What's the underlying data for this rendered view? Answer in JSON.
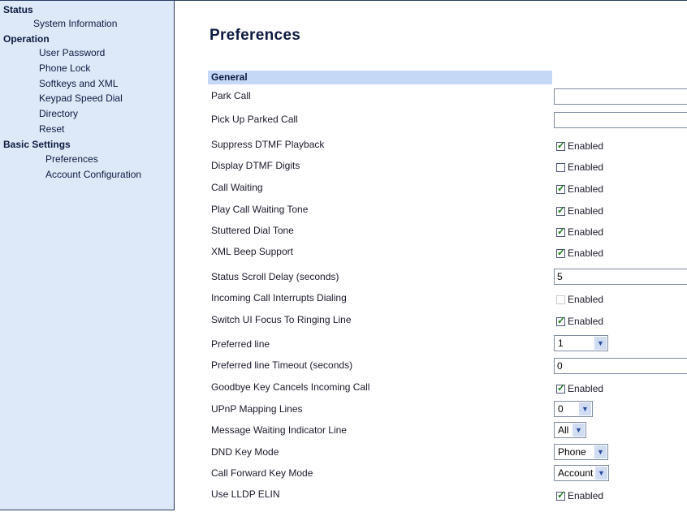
{
  "sidebar": {
    "groups": [
      {
        "label": "Status",
        "items": [
          {
            "label": "System Information"
          }
        ]
      },
      {
        "label": "Operation",
        "items": [
          {
            "label": "User Password"
          },
          {
            "label": "Phone Lock"
          },
          {
            "label": "Softkeys and XML"
          },
          {
            "label": "Keypad Speed Dial"
          },
          {
            "label": "Directory"
          },
          {
            "label": "Reset"
          }
        ]
      },
      {
        "label": "Basic Settings",
        "items": [
          {
            "label": "Preferences"
          },
          {
            "label": "Account Configuration"
          }
        ]
      }
    ]
  },
  "main": {
    "title": "Preferences",
    "section": "General",
    "enabled_label": "Enabled",
    "rows": [
      {
        "label": "Park Call",
        "type": "text",
        "value": ""
      },
      {
        "label": "Pick Up Parked Call",
        "type": "text",
        "value": ""
      },
      {
        "label": "Suppress DTMF Playback",
        "type": "checkbox",
        "checked": true
      },
      {
        "label": "Display DTMF Digits",
        "type": "checkbox",
        "checked": false
      },
      {
        "label": "Call Waiting",
        "type": "checkbox",
        "checked": true
      },
      {
        "label": "Play Call Waiting Tone",
        "type": "checkbox",
        "checked": true
      },
      {
        "label": "Stuttered Dial Tone",
        "type": "checkbox",
        "checked": true
      },
      {
        "label": "XML Beep Support",
        "type": "checkbox",
        "checked": true
      },
      {
        "label": "Status Scroll Delay (seconds)",
        "type": "text",
        "value": "5"
      },
      {
        "label": "Incoming Call Interrupts Dialing",
        "type": "checkbox",
        "checked": false
      },
      {
        "label": "Switch UI Focus To Ringing Line",
        "type": "checkbox",
        "checked": true
      },
      {
        "label": "Preferred line",
        "type": "select",
        "value": "1"
      },
      {
        "label": "Preferred line Timeout (seconds)",
        "type": "text",
        "value": "0"
      },
      {
        "label": "Goodbye Key Cancels Incoming Call",
        "type": "checkbox",
        "checked": true
      },
      {
        "label": "UPnP Mapping Lines",
        "type": "select",
        "value": "0"
      },
      {
        "label": "Message Waiting Indicator Line",
        "type": "select",
        "value": "All"
      },
      {
        "label": "DND Key Mode",
        "type": "select",
        "value": "Phone"
      },
      {
        "label": "Call Forward Key Mode",
        "type": "select",
        "value": "Account"
      },
      {
        "label": "Use LLDP ELIN",
        "type": "checkbox",
        "checked": true
      }
    ]
  }
}
